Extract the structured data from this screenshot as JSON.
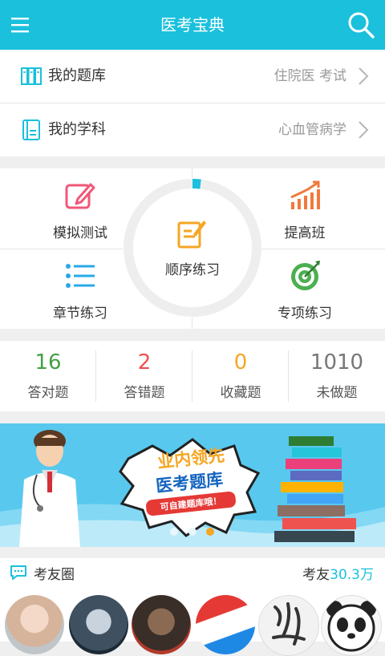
{
  "header": {
    "title": "医考宝典",
    "menu_icon": "hamburger-menu-icon",
    "search_icon": "search-icon"
  },
  "rows": [
    {
      "label": "我的题库",
      "value": "住院医 考试",
      "icon": "question-bank-icon"
    },
    {
      "label": "我的学科",
      "value": "心血管病学",
      "icon": "subject-book-icon"
    }
  ],
  "grid": {
    "mock_test": "模拟测试",
    "improvement": "提高班",
    "sequential": "顺序练习",
    "chapter": "章节练习",
    "special": "专项练习",
    "progress": 0.02
  },
  "stats": [
    {
      "value": "16",
      "label": "答对题",
      "color": "#43a047"
    },
    {
      "value": "2",
      "label": "答错题",
      "color": "#f04f4f"
    },
    {
      "value": "0",
      "label": "收藏题",
      "color": "#f5a623"
    },
    {
      "value": "1010",
      "label": "未做题",
      "color": "#777777"
    }
  ],
  "banner": {
    "headline1": "业内领先",
    "headline2": "医考题库",
    "subline": "可自建题库哦！",
    "active_dot": 2
  },
  "friends": {
    "title": "考友圈",
    "count_prefix": "考友",
    "count_value": "30.3万"
  },
  "colors": {
    "accent": "#1ac0dc",
    "orange": "#f5a623",
    "green": "#43a047",
    "red": "#f04f4f"
  }
}
